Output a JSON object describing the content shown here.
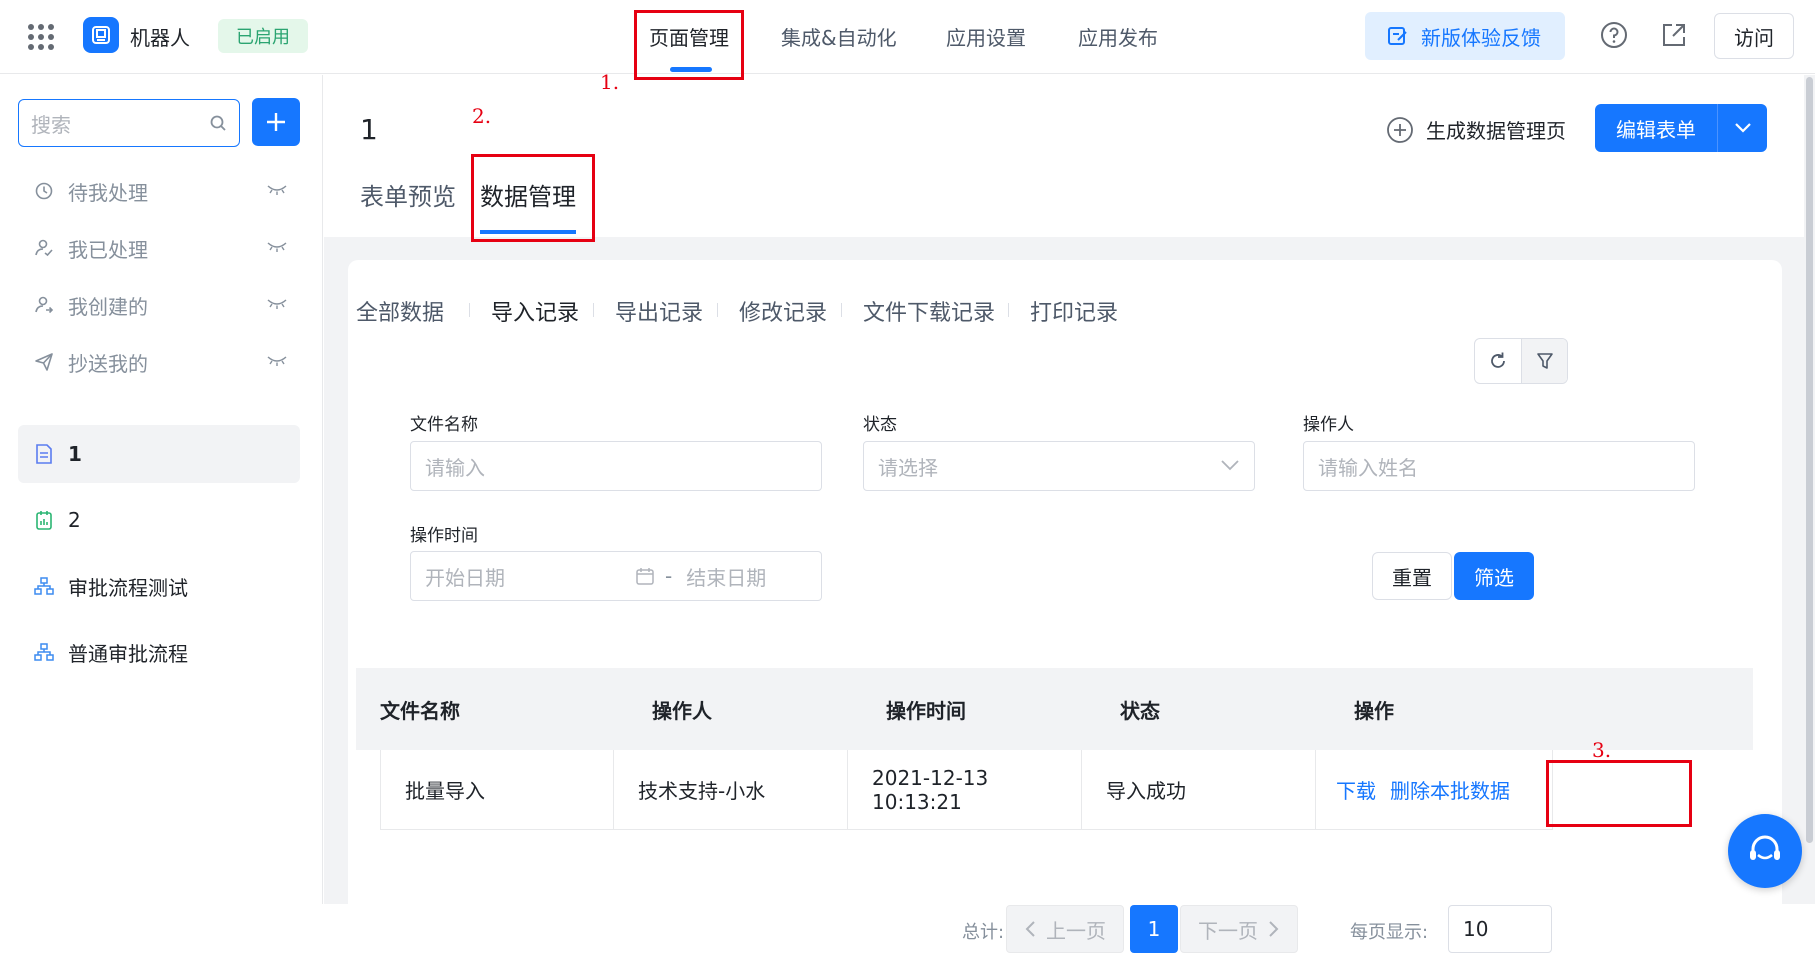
{
  "app": {
    "name": "机器人",
    "status_badge": "已启用"
  },
  "top_nav": [
    {
      "label": "页面管理",
      "active": true
    },
    {
      "label": "集成&自动化"
    },
    {
      "label": "应用设置"
    },
    {
      "label": "应用发布"
    }
  ],
  "header_actions": {
    "feedback": "新版体验反馈",
    "visit": "访问"
  },
  "sidebar": {
    "search_placeholder": "搜索",
    "items": [
      {
        "label": "待我处理",
        "icon": "clock-icon"
      },
      {
        "label": "我已处理",
        "icon": "user-check-icon"
      },
      {
        "label": "我创建的",
        "icon": "user-share-icon"
      },
      {
        "label": "抄送我的",
        "icon": "send-icon"
      },
      {
        "label": "1",
        "icon": "form-icon",
        "selected": true
      },
      {
        "label": "2",
        "icon": "report-icon"
      },
      {
        "label": "审批流程测试",
        "icon": "flow-icon"
      },
      {
        "label": "普通审批流程",
        "icon": "flow-icon"
      }
    ]
  },
  "page": {
    "title": "1",
    "generate_link": "生成数据管理页",
    "edit_button": "编辑表单",
    "tabs": [
      {
        "label": "表单预览"
      },
      {
        "label": "数据管理",
        "active": true
      }
    ]
  },
  "record_tabs": [
    {
      "label": "全部数据"
    },
    {
      "label": "导入记录",
      "active": true
    },
    {
      "label": "导出记录"
    },
    {
      "label": "修改记录"
    },
    {
      "label": "文件下载记录"
    },
    {
      "label": "打印记录"
    }
  ],
  "filters": {
    "file_name": {
      "label": "文件名称",
      "placeholder": "请输入"
    },
    "status": {
      "label": "状态",
      "placeholder": "请选择"
    },
    "operator": {
      "label": "操作人",
      "placeholder": "请输入姓名"
    },
    "time": {
      "label": "操作时间",
      "start_placeholder": "开始日期",
      "separator": "-",
      "end_placeholder": "结束日期"
    },
    "reset": "重置",
    "submit": "筛选"
  },
  "table": {
    "columns": [
      "文件名称",
      "操作人",
      "操作时间",
      "状态",
      "操作"
    ],
    "rows": [
      {
        "file": "批量导入",
        "operator": "技术支持-小水",
        "time": "2021-12-13 10:13:21",
        "status": "导入成功",
        "actions": {
          "download": "下载",
          "delete": "删除本批数据"
        }
      }
    ]
  },
  "pagination": {
    "total": "总计: 1",
    "prev": "上一页",
    "current": "1",
    "next": "下一页",
    "page_size_label": "每页显示:",
    "page_size": "10"
  },
  "annotations": {
    "step1": "1.",
    "step2": "2.",
    "step3": "3."
  },
  "colors": {
    "primary": "#1677ff",
    "annotation": "#e60012",
    "badge_bg": "#e4f7ea",
    "badge_text": "#2ba471"
  }
}
